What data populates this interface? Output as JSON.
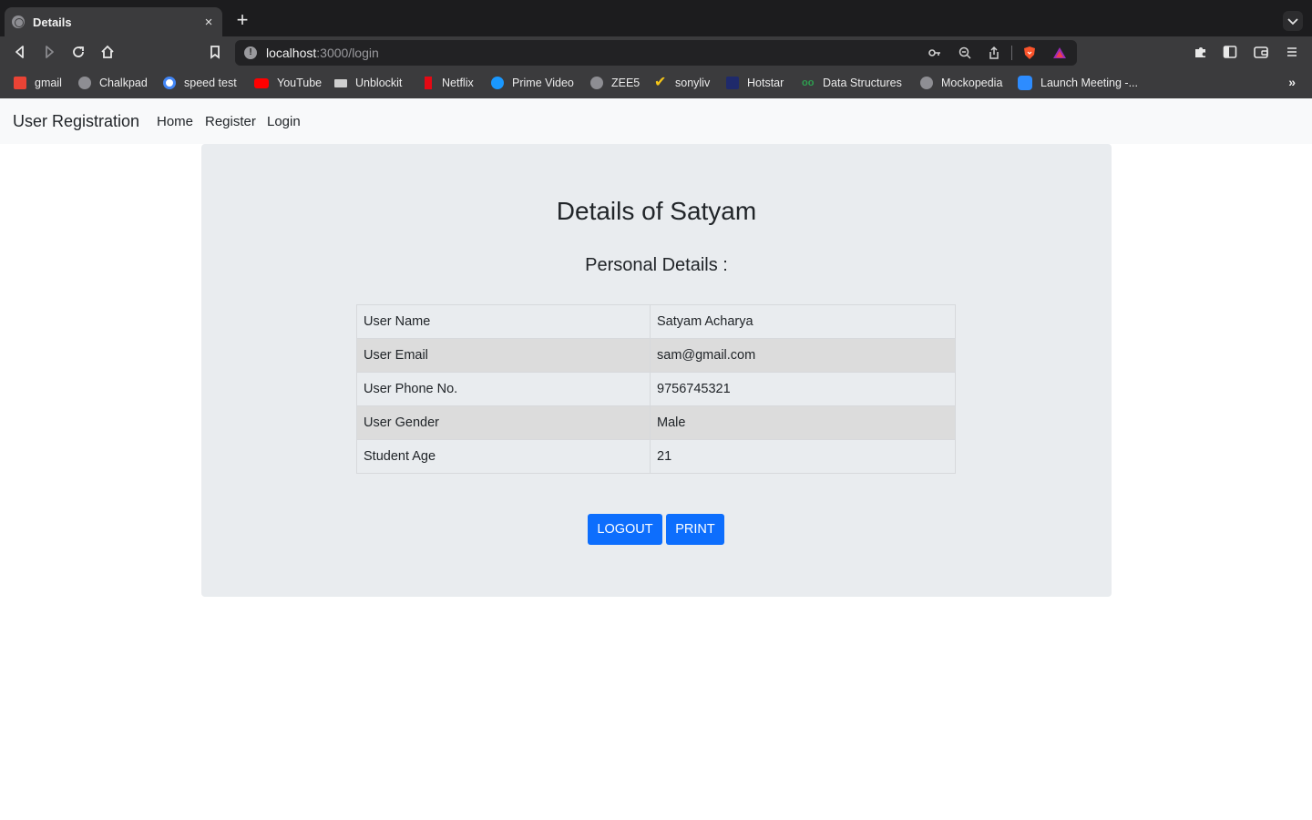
{
  "browser": {
    "tab_title": "Details",
    "tab_close": "×",
    "new_tab": "+",
    "url_host": "localhost",
    "url_rest": ":3000/login",
    "bookmarks": [
      {
        "label": "gmail",
        "color": "#ea4335"
      },
      {
        "label": "Chalkpad",
        "color": "#8e8e93"
      },
      {
        "label": "speed test",
        "color": "#ffffff"
      },
      {
        "label": "YouTube",
        "color": "#ff0000"
      },
      {
        "label": "Unblockit",
        "color": "#cfcfcf"
      },
      {
        "label": "Netflix",
        "color": "#e50914"
      },
      {
        "label": "Prime Video",
        "color": "#1a98ff"
      },
      {
        "label": "ZEE5",
        "color": "#8e8e93"
      },
      {
        "label": "sonyliv",
        "color": "#f5c518"
      },
      {
        "label": "Hotstar",
        "color": "#1f2a6b"
      },
      {
        "label": "Data Structures",
        "color": "#2e9e4f"
      },
      {
        "label": "Mockopedia",
        "color": "#8e8e93"
      },
      {
        "label": "Launch Meeting -...",
        "color": "#2d8cff"
      }
    ],
    "more_bookmarks": "»"
  },
  "navbar": {
    "brand": "User Registration",
    "links": [
      "Home",
      "Register",
      "Login"
    ]
  },
  "main": {
    "title": "Details of Satyam",
    "subtitle": "Personal Details :",
    "rows": [
      {
        "label": "User Name",
        "value": "Satyam Acharya"
      },
      {
        "label": "User Email",
        "value": "sam@gmail.com"
      },
      {
        "label": "User Phone No.",
        "value": "9756745321"
      },
      {
        "label": "User Gender",
        "value": "Male"
      },
      {
        "label": "Student Age",
        "value": "21"
      }
    ],
    "logout_label": "LOGOUT",
    "print_label": "PRINT"
  },
  "colors": {
    "primary": "#0d6efd",
    "card_bg": "#e9ecef",
    "navbar_bg": "#f8f9fa"
  }
}
